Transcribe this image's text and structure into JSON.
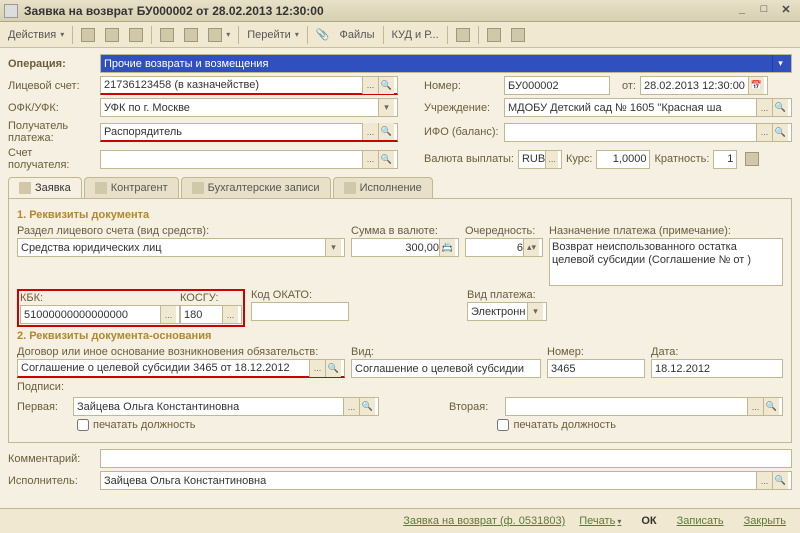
{
  "window": {
    "title": "Заявка на возврат БУ000002 от 28.02.2013 12:30:00"
  },
  "toolbar": {
    "actions": "Действия",
    "goto": "Перейти",
    "files": "Файлы",
    "kudir": "КУД и Р..."
  },
  "header": {
    "operation_lbl": "Операция:",
    "operation": "Прочие возвраты и возмещения",
    "account_lbl": "Лицевой счет:",
    "account": "21736123458 (в казначействе)",
    "number_lbl": "Номер:",
    "number": "БУ000002",
    "from_lbl": "от:",
    "date": "28.02.2013 12:30:00",
    "ofk_lbl": "ОФК/УФК:",
    "ofk": "УФК по г. Москве",
    "org_lbl": "Учреждение:",
    "org": "МДОБУ  Детский сад № 1605 \"Красная ша",
    "payer_lbl": "Получатель платежа:",
    "payer": "Распорядитель",
    "ifo_lbl": "ИФО (баланс):",
    "ifo": "",
    "payer_acc_lbl": "Счет получателя:",
    "payer_acc": "",
    "currency_lbl": "Валюта выплаты:",
    "currency": "RUB",
    "rate_lbl": "Курс:",
    "rate": "1,0000",
    "mult_lbl": "Кратность:",
    "mult": "1"
  },
  "tabs": {
    "t1": "Заявка",
    "t2": "Контрагент",
    "t3": "Бухгалтерские записи",
    "t4": "Исполнение"
  },
  "sec1": {
    "title": "1. Реквизиты документа",
    "razdel_lbl": "Раздел лицевого счета (вид средств):",
    "razdel": "Средства юридических лиц",
    "sum_lbl": "Сумма в валюте:",
    "sum": "300,00",
    "order_lbl": "Очередность:",
    "order": "6",
    "purpose_lbl": "Назначение платежа (примечание):",
    "purpose": "Возврат неиспользованного остатка целевой субсидии (Соглашение №   от   )",
    "kbk_lbl": "КБК:",
    "kbk": "51000000000000000",
    "kosgu_lbl": "КОСГУ:",
    "kosgu": "180",
    "okato_lbl": "Код ОКАТО:",
    "okato": "",
    "paytype_lbl": "Вид платежа:",
    "paytype": "Электронн"
  },
  "sec2": {
    "title": "2. Реквизиты документа-основания",
    "basis_lbl": "Договор или иное основание возникновения обязательств:",
    "basis": "Соглашение о целевой субсидии 3465 от 18.12.2012",
    "kind_lbl": "Вид:",
    "kind": "Соглашение о целевой субсидии",
    "num_lbl": "Номер:",
    "num": "3465",
    "date_lbl": "Дата:",
    "date": "18.12.2012"
  },
  "sign": {
    "title": "Подписи:",
    "first_lbl": "Первая:",
    "first": "Зайцева Ольга Константиновна",
    "second_lbl": "Вторая:",
    "second": "",
    "print_lbl": "печатать должность"
  },
  "footer": {
    "comment_lbl": "Комментарий:",
    "comment": "",
    "exec_lbl": "Исполнитель:",
    "exec": "Зайцева Ольга Константиновна"
  },
  "bottom": {
    "formname": "Заявка на возврат (ф. 0531803)",
    "print": "Печать",
    "ok": "ОК",
    "save": "Записать",
    "close": "Закрыть"
  }
}
